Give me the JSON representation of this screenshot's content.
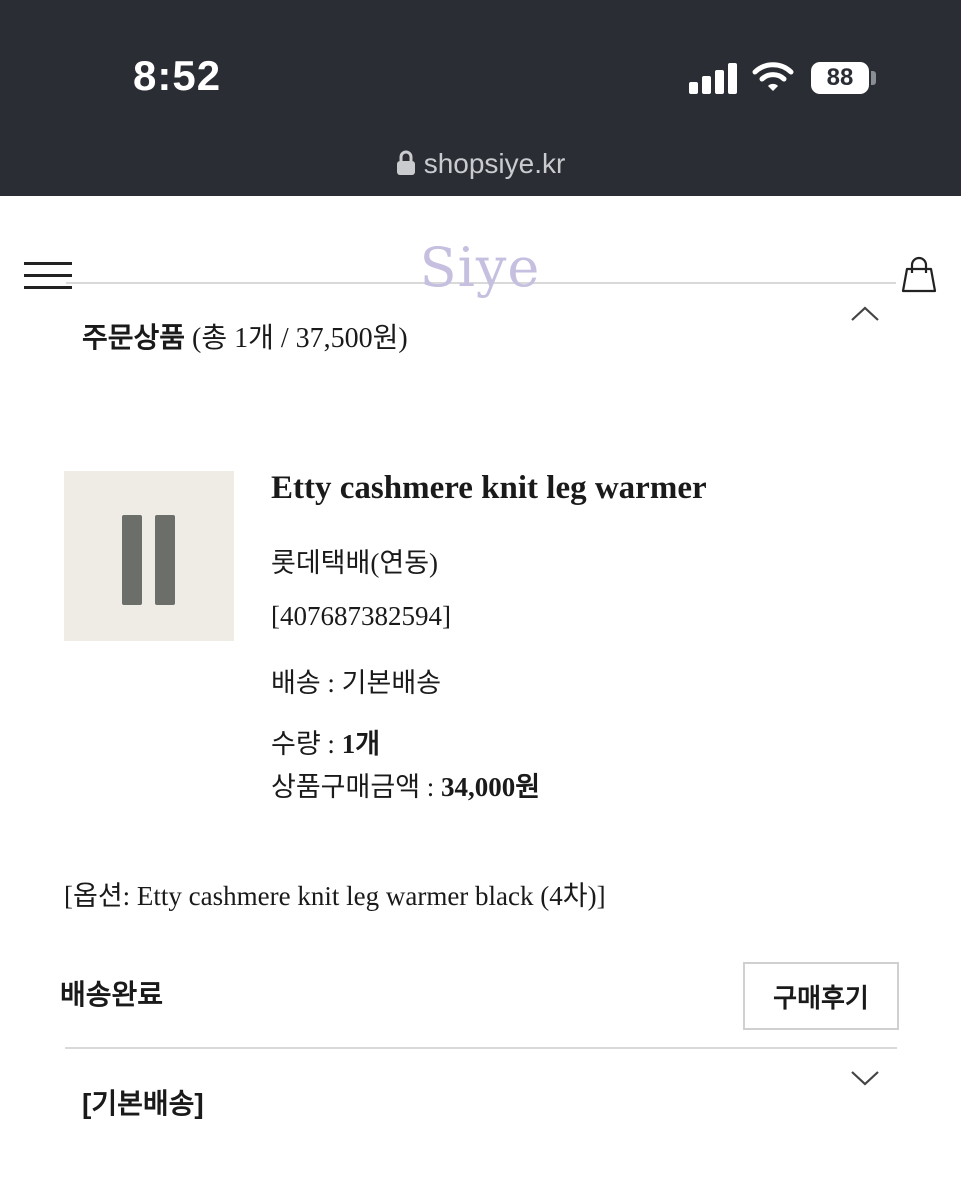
{
  "status_bar": {
    "time": "8:52",
    "battery": "88",
    "url": "shopsiye.kr"
  },
  "header": {
    "logo": "Siye",
    "logo_color": "#c6bfe0"
  },
  "order_section": {
    "title_bold": "주문상품",
    "title_rest": "(총 1개 / 37,500원)"
  },
  "product": {
    "name": "Etty cashmere knit leg warmer",
    "courier": "롯데택배(연동)",
    "tracking": "[407687382594]",
    "shipping_label": "배송 : 기본배송",
    "qty_label": "수량 : ",
    "qty_value": "1개",
    "price_label": "상품구매금액 : ",
    "price_value": "34,000원",
    "option": "[옵션: Etty cashmere knit leg warmer black (4차)]"
  },
  "order_status": "배송완료",
  "review_button": "구매후기",
  "shipping_group": "[기본배송]",
  "icons": [
    "lock-icon",
    "menu-icon",
    "shopping-bag-icon",
    "chevron-up-icon",
    "chevron-down-icon",
    "signal-icon",
    "wifi-icon",
    "battery-icon"
  ]
}
